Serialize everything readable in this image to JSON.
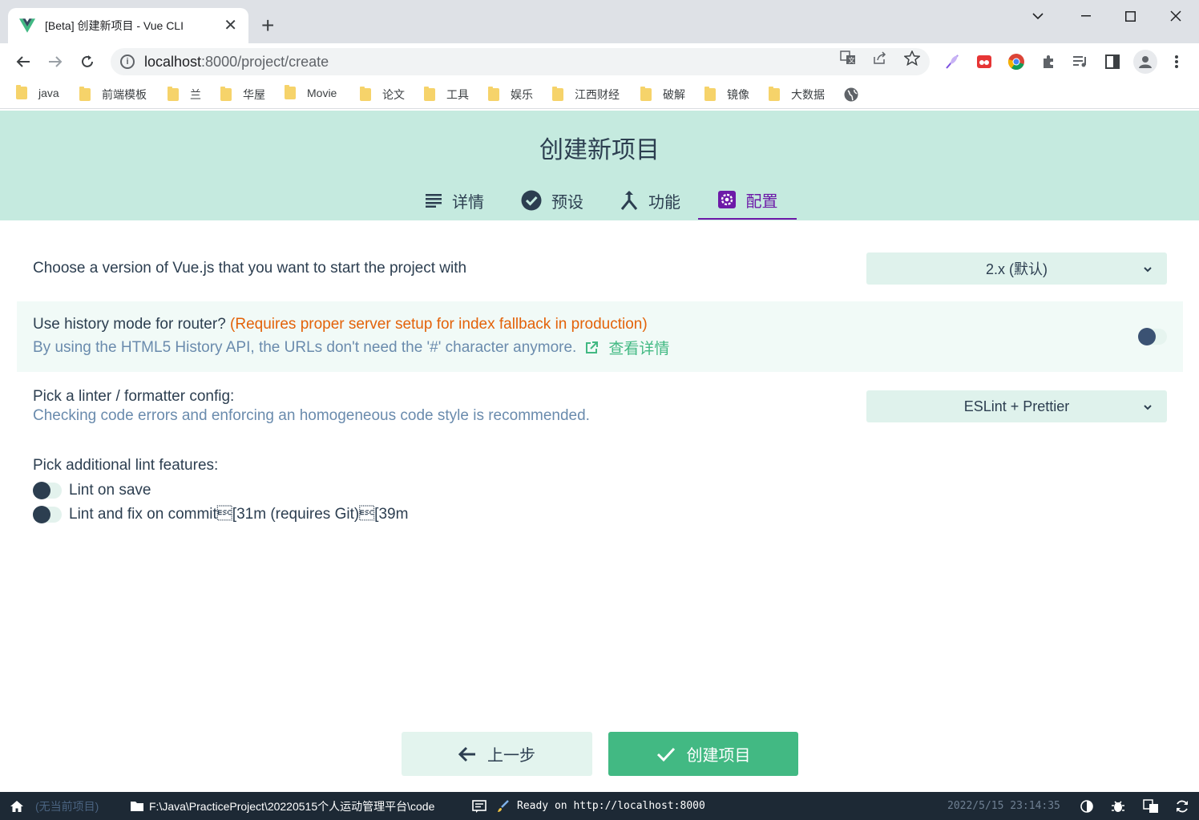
{
  "browser": {
    "tab_title": "[Beta] 创建新项目 - Vue CLI",
    "tab_close": "✕",
    "new_tab": "+",
    "url_host": "localhost",
    "url_rest": ":8000/project/create",
    "bookmarks": [
      "java",
      "前端模板",
      "兰",
      "华屋",
      "Movie",
      "论文",
      "工具",
      "娱乐",
      "江西财经",
      "破解",
      "镜像",
      "大数据"
    ]
  },
  "header": {
    "title": "创建新项目",
    "steps": [
      {
        "label": "详情",
        "icon": "list-icon"
      },
      {
        "label": "预设",
        "icon": "check-circle-icon"
      },
      {
        "label": "功能",
        "icon": "merge-icon"
      },
      {
        "label": "配置",
        "icon": "settings-icon",
        "active": true
      }
    ]
  },
  "config": {
    "vue_version": {
      "label": "Choose a version of Vue.js that you want to start the project with",
      "selected": "2.x (默认)"
    },
    "history_mode": {
      "label": "Use history mode for router?",
      "warning": "(Requires proper server setup for index fallback in production)",
      "description": "By using the HTML5 History API, the URLs don't need the '#' character anymore.",
      "link_text": "查看详情",
      "enabled": false
    },
    "linter": {
      "label": "Pick a linter / formatter config:",
      "description": "Checking code errors and enforcing an homogeneous code style is recommended.",
      "selected": "ESLint + Prettier"
    },
    "lint_features": {
      "label": "Pick additional lint features:",
      "options": [
        {
          "label": "Lint on save",
          "enabled": false
        },
        {
          "label": "Lint and fix on commit\u001b[31m (requires Git)\u001b[39m",
          "enabled": false
        }
      ]
    }
  },
  "actions": {
    "back": "上一步",
    "create": "创建项目"
  },
  "statusbar": {
    "project": "(无当前项目)",
    "path": "F:\\Java\\PracticeProject\\20220515个人运动管理平台\\code",
    "log": "Ready on http://localhost:8000",
    "datetime": "2022/5/15 23:14:35"
  },
  "colors": {
    "header_bg": "#c5eadf",
    "accent_green": "#42b983",
    "active_purple": "#6d1aa8",
    "warning_orange": "#e36209",
    "statusbar_bg": "#1d2935"
  }
}
